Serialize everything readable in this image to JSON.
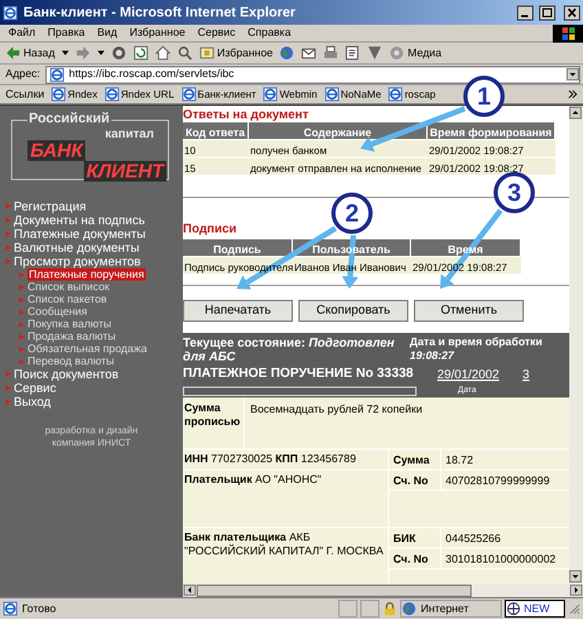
{
  "window": {
    "title": "Банк-клиент - Microsoft Internet Explorer"
  },
  "menu": [
    "Файл",
    "Правка",
    "Вид",
    "Избранное",
    "Сервис",
    "Справка"
  ],
  "toolbar": {
    "back": "Назад",
    "favorites": "Избранное",
    "media": "Медиа"
  },
  "address": {
    "label": "Адрес:",
    "value": "https://ibc.roscap.com/servlets/ibc"
  },
  "links": {
    "label": "Ссылки",
    "items": [
      "Яndex",
      "Яndex URL",
      "Банк-клиент",
      "Webmin",
      "NoNaMe",
      "roscap"
    ]
  },
  "logo": {
    "line1": "Российский",
    "line2": "капитал",
    "line3": "БАНК",
    "line4": "КЛИЕНТ"
  },
  "nav": [
    {
      "label": "Регистрация"
    },
    {
      "label": "Документы на подпись"
    },
    {
      "label": "Платежные документы"
    },
    {
      "label": "Валютные документы"
    },
    {
      "label": "Просмотр документов",
      "children": [
        {
          "label": "Платежные поручения",
          "selected": true
        },
        {
          "label": "Список выписок",
          "selected": false
        },
        {
          "label": "Список пакетов",
          "selected": false
        },
        {
          "label": "Сообщения",
          "selected": false
        },
        {
          "label": "Покупка валюты",
          "selected": false
        },
        {
          "label": "Продажа валюты",
          "selected": false
        },
        {
          "label": "Обязательная продажа",
          "selected": false
        },
        {
          "label": "Перевод валюты",
          "selected": false
        }
      ]
    },
    {
      "label": "Поиск документов"
    },
    {
      "label": "Сервис"
    },
    {
      "label": "Выход"
    }
  ],
  "credit": "разработка и дизайн компания ИНИСТ",
  "responses": {
    "title": "Ответы на документ",
    "columns": [
      "Код ответа",
      "Содержание",
      "Время формирования"
    ],
    "rows": [
      [
        "10",
        "получен банком",
        "29/01/2002 19:08:27"
      ],
      [
        "15",
        "документ отправлен на исполнение",
        "29/01/2002 19:08:27"
      ]
    ]
  },
  "signatures": {
    "title": "Подписи",
    "columns": [
      "Подпись",
      "Пользователь",
      "Время"
    ],
    "rows": [
      [
        "Подпись руководителя",
        "Иванов Иван Иванович",
        "29/01/2002 19:08:27"
      ]
    ]
  },
  "buttons": [
    "Напечатать",
    "Скопировать",
    "Отменить"
  ],
  "document": {
    "status_label": "Текущее состояние:",
    "status": "Подготовлен для АБС",
    "processed_label": "Дата и время обработки",
    "processed_time": "19:08:27",
    "title": "ПЛАТЕЖНОЕ ПОРУЧЕНИЕ No 33338",
    "date": "29/01/2002",
    "date_caption": "Дата",
    "column_3": "3"
  },
  "form": {
    "amount_words_label": "Сумма прописью",
    "amount_words": "Восемнадцать рублей 72 копейки",
    "inn": "**ИНН** 7702730025 **КПП** 123456789",
    "amount_label": "Сумма",
    "amount": "18.72",
    "payer": "**Плательщик** АО \"АНОНС\"",
    "payer_account_label": "Сч. No",
    "payer_account": "40702810799999999",
    "bank": "**Банк плательщика** АКБ \"РОССИЙСКИЙ КАПИТАЛ\" Г. МОСКВА",
    "bic_label": "БИК",
    "bic": "044525266",
    "bank_account_label": "Сч. No",
    "bank_account": "301018101000000002"
  },
  "status_bar": {
    "text": "Готово",
    "zone": "Интернет",
    "badge": "NEW"
  },
  "callouts": [
    "1",
    "2",
    "3"
  ]
}
